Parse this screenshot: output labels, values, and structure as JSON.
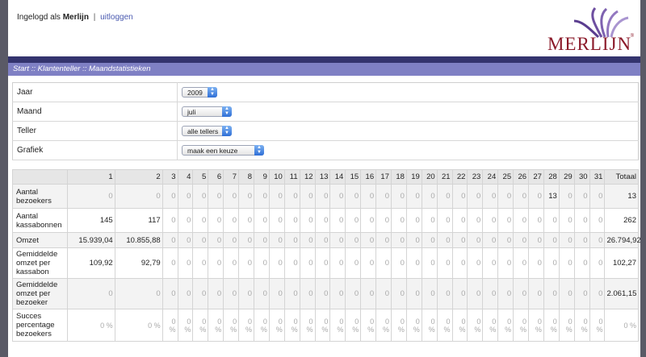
{
  "header": {
    "login_prefix": "Ingelogd als",
    "username": "Merlijn",
    "separator": "|",
    "logout_link": "uitloggen",
    "logo_text": "MERLIJN",
    "logo_mark": "®"
  },
  "breadcrumb": "Start :: Klantenteller :: Maandstatistieken",
  "filters": [
    {
      "label": "Jaar",
      "value": "2009"
    },
    {
      "label": "Maand",
      "value": "juli"
    },
    {
      "label": "Teller",
      "value": "alle tellers"
    },
    {
      "label": "Grafiek",
      "value": "maak een keuze"
    }
  ],
  "table": {
    "days": [
      "1",
      "2",
      "3",
      "4",
      "5",
      "6",
      "7",
      "8",
      "9",
      "10",
      "11",
      "12",
      "13",
      "14",
      "15",
      "16",
      "17",
      "18",
      "19",
      "20",
      "21",
      "22",
      "23",
      "24",
      "25",
      "26",
      "27",
      "28",
      "29",
      "30",
      "31"
    ],
    "total_header": "Totaal",
    "rows": [
      {
        "label": "Aantal bezoekers",
        "values": [
          "0",
          "0",
          "0",
          "0",
          "0",
          "0",
          "0",
          "0",
          "0",
          "0",
          "0",
          "0",
          "0",
          "0",
          "0",
          "0",
          "0",
          "0",
          "0",
          "0",
          "0",
          "0",
          "0",
          "0",
          "0",
          "0",
          "0",
          "13",
          "0",
          "0",
          "0"
        ],
        "total": "13"
      },
      {
        "label": "Aantal kassabonnen",
        "values": [
          "145",
          "117",
          "0",
          "0",
          "0",
          "0",
          "0",
          "0",
          "0",
          "0",
          "0",
          "0",
          "0",
          "0",
          "0",
          "0",
          "0",
          "0",
          "0",
          "0",
          "0",
          "0",
          "0",
          "0",
          "0",
          "0",
          "0",
          "0",
          "0",
          "0",
          "0"
        ],
        "total": "262"
      },
      {
        "label": "Omzet",
        "values": [
          "15.939,04",
          "10.855,88",
          "0",
          "0",
          "0",
          "0",
          "0",
          "0",
          "0",
          "0",
          "0",
          "0",
          "0",
          "0",
          "0",
          "0",
          "0",
          "0",
          "0",
          "0",
          "0",
          "0",
          "0",
          "0",
          "0",
          "0",
          "0",
          "0",
          "0",
          "0",
          "0"
        ],
        "total": "26.794,92"
      },
      {
        "label": "Gemiddelde omzet per kassabon",
        "values": [
          "109,92",
          "92,79",
          "0",
          "0",
          "0",
          "0",
          "0",
          "0",
          "0",
          "0",
          "0",
          "0",
          "0",
          "0",
          "0",
          "0",
          "0",
          "0",
          "0",
          "0",
          "0",
          "0",
          "0",
          "0",
          "0",
          "0",
          "0",
          "0",
          "0",
          "0",
          "0"
        ],
        "total": "102,27"
      },
      {
        "label": "Gemiddelde omzet per bezoeker",
        "values": [
          "0",
          "0",
          "0",
          "0",
          "0",
          "0",
          "0",
          "0",
          "0",
          "0",
          "0",
          "0",
          "0",
          "0",
          "0",
          "0",
          "0",
          "0",
          "0",
          "0",
          "0",
          "0",
          "0",
          "0",
          "0",
          "0",
          "0",
          "0",
          "0",
          "0",
          "0"
        ],
        "total": "2.061,15"
      },
      {
        "label": "Succes percentage bezoekers",
        "values": [
          "0 %",
          "0 %",
          "0 %",
          "0 %",
          "0 %",
          "0 %",
          "0 %",
          "0 %",
          "0 %",
          "0 %",
          "0 %",
          "0 %",
          "0 %",
          "0 %",
          "0 %",
          "0 %",
          "0 %",
          "0 %",
          "0 %",
          "0 %",
          "0 %",
          "0 %",
          "0 %",
          "0 %",
          "0 %",
          "0 %",
          "0 %",
          "0 %",
          "0 %",
          "0 %",
          "0 %"
        ],
        "total": "0 %"
      }
    ]
  }
}
